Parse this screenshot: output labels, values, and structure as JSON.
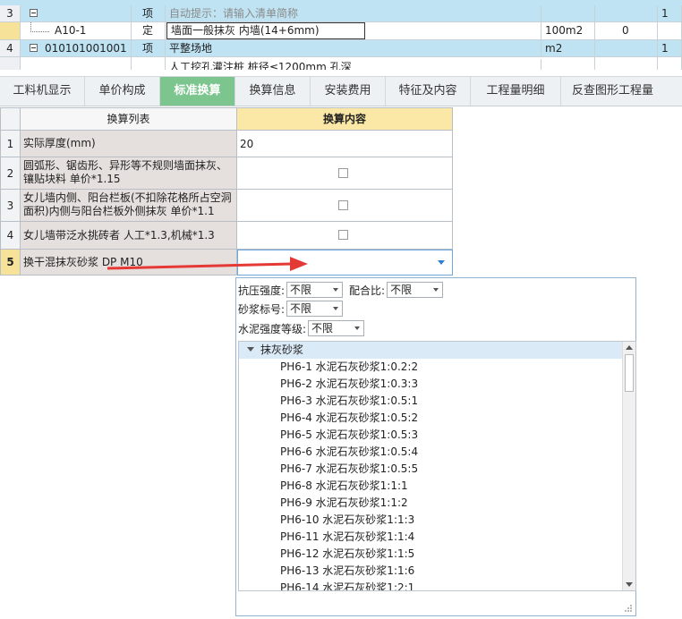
{
  "top_grid": {
    "rows": [
      {
        "num": "3",
        "code": "",
        "type": "项",
        "name": "自动提示：请输入清单简称",
        "unit": "",
        "qty": "",
        "extra": "1"
      },
      {
        "num": "",
        "code": "A10-1",
        "type": "定",
        "name": "墙面一般抹灰 内墙(14+6mm)",
        "unit": "100m2",
        "qty": "0",
        "extra": ""
      },
      {
        "num": "4",
        "code": "010101001001",
        "type": "项",
        "name": "平整场地",
        "unit": "m2",
        "qty": "",
        "extra": "1"
      },
      {
        "num": "",
        "code": "",
        "type": "",
        "name": "人工挖孔灌注桩 桩径≤1200mm 孔深",
        "unit": "",
        "qty": "",
        "extra": ""
      }
    ]
  },
  "tabs": [
    {
      "label": "工料机显示",
      "active": false
    },
    {
      "label": "单价构成",
      "active": false
    },
    {
      "label": "标准换算",
      "active": true
    },
    {
      "label": "换算信息",
      "active": false
    },
    {
      "label": "安装费用",
      "active": false
    },
    {
      "label": "特征及内容",
      "active": false
    },
    {
      "label": "工程量明细",
      "active": false
    },
    {
      "label": "反查图形工程量",
      "active": false
    }
  ],
  "conversion_table": {
    "col_list": "换算列表",
    "col_content": "换算内容",
    "rows": [
      {
        "idx": "1",
        "name": "实际厚度(mm)",
        "value": "20",
        "kind": "text"
      },
      {
        "idx": "2",
        "name": "圆弧形、锯齿形、异形等不规则墙面抹灰、镶贴块料 单价*1.15",
        "value": "",
        "kind": "checkbox"
      },
      {
        "idx": "3",
        "name": "女儿墙内侧、阳台栏板(不扣除花格所占空洞面积)内侧与阳台栏板外侧抹灰 单价*1.1",
        "value": "",
        "kind": "checkbox"
      },
      {
        "idx": "4",
        "name": "女儿墙带泛水挑砖者 人工*1.3,机械*1.3",
        "value": "",
        "kind": "checkbox"
      },
      {
        "idx": "5",
        "name": "换干混抹灰砂浆 DP M10",
        "value": "",
        "kind": "dropdown"
      }
    ]
  },
  "dropdown_panel": {
    "filters": {
      "strength_label": "抗压强度:",
      "strength_value": "不限",
      "ratio_label": "配合比:",
      "ratio_value": "不限",
      "mortar_label": "砂浆标号:",
      "mortar_value": "不限",
      "cement_label": "水泥强度等级:",
      "cement_value": "不限"
    },
    "group_label": "抹灰砂浆",
    "items": [
      "PH6-1  水泥石灰砂浆1:0.2:2",
      "PH6-2  水泥石灰砂浆1:0.3:3",
      "PH6-3  水泥石灰砂浆1:0.5:1",
      "PH6-4  水泥石灰砂浆1:0.5:2",
      "PH6-5  水泥石灰砂浆1:0.5:3",
      "PH6-6  水泥石灰砂浆1:0.5:4",
      "PH6-7  水泥石灰砂浆1:0.5:5",
      "PH6-8  水泥石灰砂浆1:1:1",
      "PH6-9  水泥石灰砂浆1:1:2",
      "PH6-10  水泥石灰砂浆1:1:3",
      "PH6-11  水泥石灰砂浆1:1:4",
      "PH6-12  水泥石灰砂浆1:1:5",
      "PH6-13  水泥石灰砂浆1:1:6",
      "PH6-14  水泥石灰砂浆1:2:1"
    ]
  },
  "colors": {
    "tab_active": "#7cc58e",
    "row_highlight": "#bfe3f3",
    "header_yellow": "#fbe7a6",
    "arrow_red": "#e53935",
    "dropdown_arrow": "#2f7fd0"
  }
}
